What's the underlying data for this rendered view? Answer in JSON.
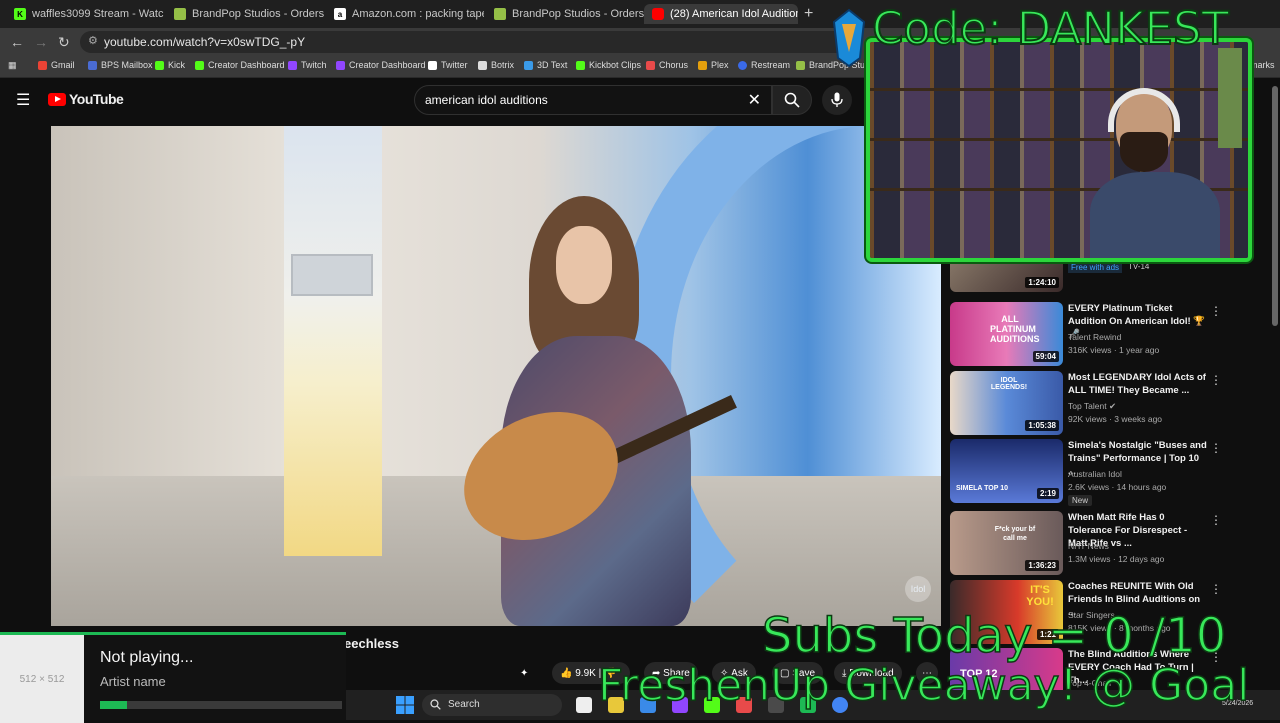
{
  "browser": {
    "tabs": [
      {
        "label": "waffles3099 Stream - Watc",
        "favicon": "kick-icon",
        "color": "#53fc18",
        "muted": true
      },
      {
        "label": "BrandPop Studios - Orders - #1",
        "favicon": "shopify-icon",
        "color": "#95bf47"
      },
      {
        "label": "Amazon.com : packing tape",
        "favicon": "amazon-icon",
        "color": "#ffffff"
      },
      {
        "label": "BrandPop Studios - Orders - #1",
        "favicon": "shopify-icon",
        "color": "#95bf47"
      },
      {
        "label": "(28) American Idol Audition",
        "favicon": "youtube-icon",
        "color": "#ff0000",
        "active": true
      }
    ],
    "url": "youtube.com/watch?v=x0swTDG_-pY",
    "bookmarks": [
      {
        "label": "Gmail",
        "color": "#ea4335"
      },
      {
        "label": "BPS Mailbox",
        "color": "#4a6cd4"
      },
      {
        "label": "Kick",
        "color": "#53fc18"
      },
      {
        "label": "Creator Dashboard",
        "color": "#53fc18"
      },
      {
        "label": "Twitch",
        "color": "#9146ff"
      },
      {
        "label": "Creator Dashboard",
        "color": "#9146ff"
      },
      {
        "label": "Twitter",
        "color": "#ffffff"
      },
      {
        "label": "Botrix",
        "color": "#dddddd"
      },
      {
        "label": "3D Text",
        "color": "#3a9ae8"
      },
      {
        "label": "Kickbot Clips",
        "color": "#53fc18"
      },
      {
        "label": "Chorus",
        "color": "#e84a4a"
      },
      {
        "label": "Plex",
        "color": "#e5a00d"
      },
      {
        "label": "Restream",
        "color": "#3a6ae8"
      },
      {
        "label": "BrandPop Studi",
        "color": "#95bf47"
      }
    ],
    "bookmarks_trailing": "marks"
  },
  "youtube": {
    "logo": "YouTube",
    "search_query": "american idol auditions",
    "video_title_fragment": "eechless",
    "watermark": "Idol",
    "actions": {
      "likes": "9.9K",
      "share": "Share",
      "ask": "Ask",
      "save": "Save",
      "download": "Download"
    }
  },
  "sidebar": {
    "first": {
      "duration": "1:24:10",
      "free_tag": "Free with ads",
      "rating": "TV-14"
    },
    "items": [
      {
        "title": "EVERY Platinum Ticket Audition On American Idol! 🏆 🎤",
        "channel": "Talent Rewind",
        "meta": "316K views · 1 year ago",
        "duration": "59:04",
        "thumb_text": "ALL PLATINUM AUDITIONS",
        "thumb_color": "#c83a8a"
      },
      {
        "title": "Most LEGENDARY Idol Acts of ALL TIME! They Became ...",
        "channel": "Top Talent ✔",
        "meta": "92K views · 3 weeks ago",
        "duration": "1:05:38",
        "thumb_text": "IDOL LEGENDS!",
        "thumb_color": "#3a6ad8"
      },
      {
        "title": "Simela's Nostalgic \"Buses and Trains\" Performance | Top 10 ...",
        "channel": "Australian Idol",
        "meta": "2.6K views · 14 hours ago",
        "duration": "2:19",
        "thumb_text": "SIMELA TOP 10",
        "thumb_color": "#2a3a8a",
        "badge": "New"
      },
      {
        "title": "When Matt Rife Has 0 Tolerance For Disrespect - Matt Rife vs ...",
        "channel": "NHT News",
        "meta": "1.3M views · 12 days ago",
        "duration": "1:36:23",
        "thumb_text": "F*ck your bf call me",
        "thumb_color": "#8a6a5a"
      },
      {
        "title": "Coaches REUNITE With Old Friends In Blind Auditions on ...",
        "channel": "Star Singers",
        "meta": "815K views · 8 months ago",
        "duration": "1:21",
        "thumb_text": "IT'S YOU!",
        "thumb_color": "#d83a2a"
      },
      {
        "title": "The Blind Auditions Where EVERY Coach Had To Turn | Th...",
        "channel": "Top 4-Chair",
        "meta": "",
        "duration": "",
        "thumb_text": "TOP 12",
        "thumb_color": "#6a3aa8"
      }
    ]
  },
  "overlay": {
    "code": "Code: DANKEST",
    "subs": "Subs Today = 0  /10",
    "giveaway": "FreshenUp Giveaway! @ Goal"
  },
  "now_playing": {
    "art_placeholder": "512 × 512",
    "status": "Not playing...",
    "artist": "Artist name",
    "progress": 0.11
  },
  "taskbar": {
    "search": "Search",
    "time": "5/24/2026"
  },
  "colors": {
    "overlay_green": "#38e85a",
    "spotify_green": "#1db954",
    "yt_red": "#ff0000"
  }
}
